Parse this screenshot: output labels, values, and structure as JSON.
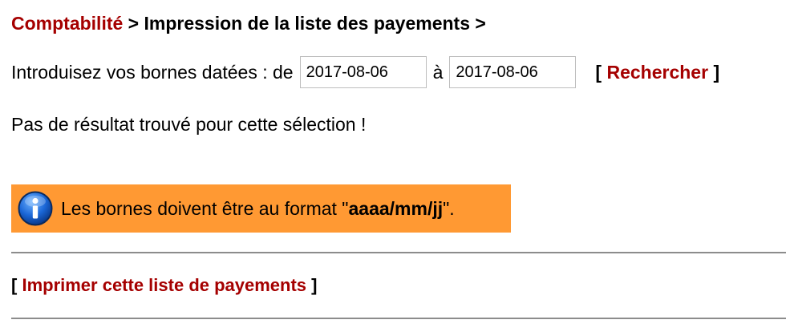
{
  "breadcrumb": {
    "link": "Comptabilité",
    "separator1": ">",
    "current": "Impression de la liste des payements",
    "separator2": ">"
  },
  "date_range": {
    "label": "Introduisez vos bornes datées : de",
    "from_value": "2017-08-06",
    "to_label": "à",
    "to_value": "2017-08-06"
  },
  "search": {
    "bracket_open": "[",
    "label": "Rechercher",
    "bracket_close": "]"
  },
  "message": {
    "no_result": "Pas de résultat trouvé pour cette sélection !"
  },
  "info": {
    "icon": "info-icon",
    "text_before": "Les bornes doivent être au format \"",
    "format": "aaaa/mm/jj",
    "text_after": "\"."
  },
  "print": {
    "bracket_open": "[",
    "label": "Imprimer cette liste de payements",
    "bracket_close": "]"
  },
  "colors": {
    "link": "#a50000",
    "info_background": "#ff9933",
    "divider": "#8c8c8c"
  }
}
